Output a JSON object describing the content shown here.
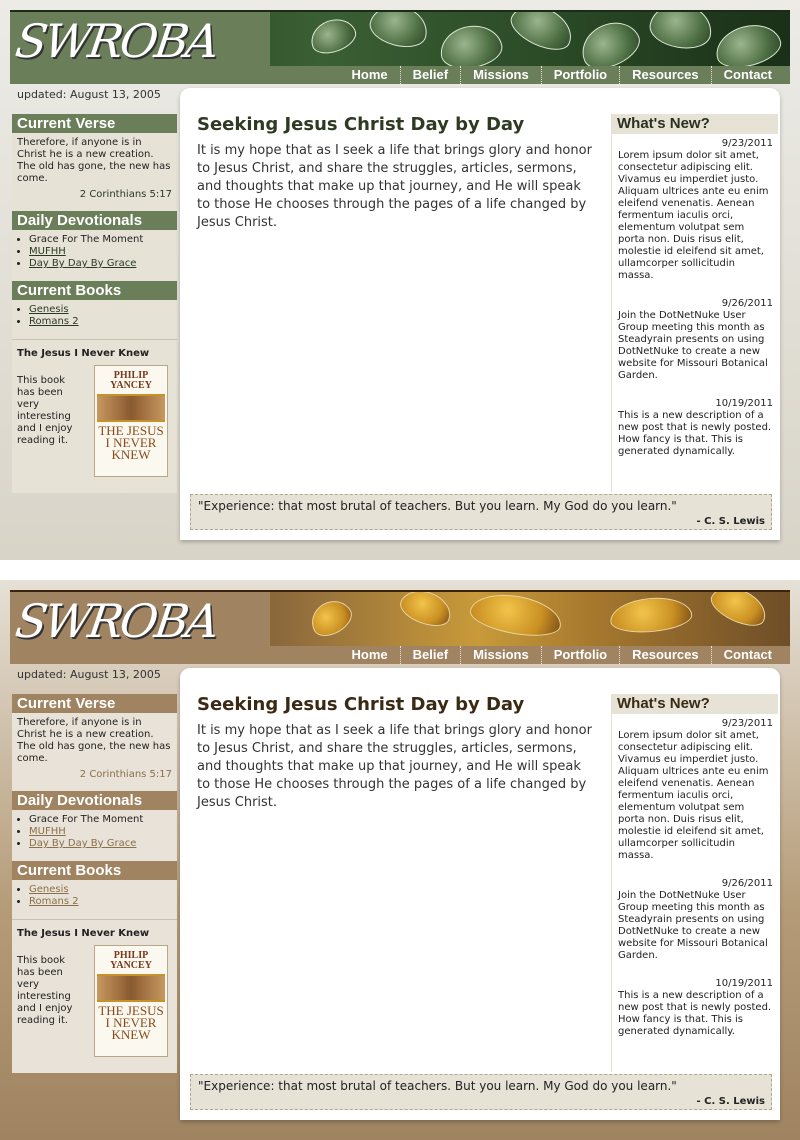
{
  "logo": "SWROBA",
  "nav": [
    "Home",
    "Belief",
    "Missions",
    "Portfolio",
    "Resources",
    "Contact"
  ],
  "updated": "updated: August 13, 2005",
  "verse": {
    "heading": "Current Verse",
    "text": "Therefore, if anyone is in Christ he is a new creation. The old has gone, the new has come.",
    "reference": "2 Corinthians 5:17"
  },
  "devotionals": {
    "heading": "Daily Devotionals",
    "items": [
      "Grace For The Moment",
      "MUFHH",
      "Day By Day By Grace"
    ]
  },
  "books": {
    "heading": "Current Books",
    "items": [
      "Genesis",
      "Romans 2"
    ],
    "featured_title": "The Jesus I Never Knew",
    "featured_text": "This book has been very interesting and I enjoy reading it.",
    "cover_author": "PHILIP YANCEY",
    "cover_title": "THE JESUS I NEVER KNEW"
  },
  "main": {
    "title": "Seeking Jesus Christ Day by Day",
    "intro": "It is my hope that as I seek a life that brings glory and honor to Jesus Christ, and share the struggles, articles, sermons, and thoughts that make up that journey, and He will speak to those He chooses through the pages of a life changed by Jesus Christ."
  },
  "whats_new": {
    "heading": "What's New?",
    "items": [
      {
        "date": "9/23/2011",
        "text": "Lorem ipsum dolor sit amet, consectetur adipiscing elit. Vivamus eu imperdiet justo. Aliquam ultrices ante eu enim eleifend venenatis. Aenean fermentum iaculis orci, elementum volutpat sem porta non. Duis risus elit, molestie id eleifend sit amet, ullamcorper sollicitudin massa."
      },
      {
        "date": "9/26/2011",
        "text": "Join the DotNetNuke User Group meeting this month as Steadyrain presents on using DotNetNuke to create a new website for Missouri Botanical Garden."
      },
      {
        "date": "10/19/2011",
        "text": "This is a new description of a new post that is newly posted.  How fancy is that. This is generated dynamically."
      }
    ]
  },
  "quote": {
    "text": "\"Experience: that most brutal of teachers. But you learn. My God do you learn.\"",
    "author": "- C. S. Lewis"
  },
  "themes": {
    "green": {
      "accent": "#6a7e5a"
    },
    "brown": {
      "accent": "#a08462"
    }
  }
}
